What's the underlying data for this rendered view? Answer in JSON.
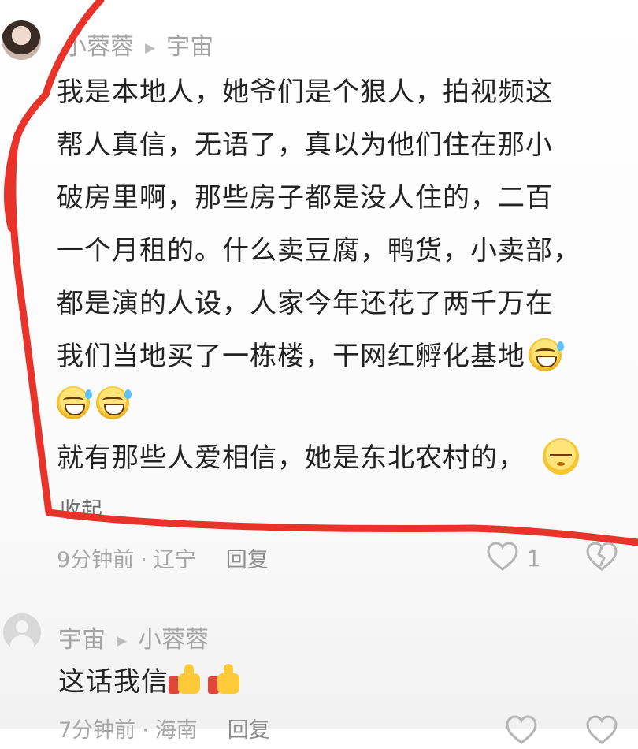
{
  "comment1": {
    "username": "小蓉蓉",
    "reply_to": "宇宙",
    "lines": [
      "我是本地人，她爷们是个狠人，拍视频这",
      "帮人真信，无语了，真以为他们住在那小",
      "破房里啊，那些房子都是没人住的，二百",
      "一个月租的。什么卖豆腐，鸭货，小卖部，",
      "都是演的人设，人家今年还花了两千万在",
      "我们当地买了一栋楼，干网红孵化基地"
    ],
    "last_line": "就有那些人爱相信，她是东北农村的，",
    "collapse_label": "收起",
    "time": "9分钟前",
    "location": "辽宁",
    "reply_label": "回复",
    "like_count": "1",
    "emoji_names": [
      "laugh-cry-emoji",
      "laugh-cry-emoji",
      "laugh-cry-emoji",
      "sleepy-emoji"
    ]
  },
  "comment2": {
    "username": "宇宙",
    "reply_to": "小蓉蓉",
    "text": "这话我信",
    "time": "7分钟前",
    "location": "海南",
    "reply_label": "回复"
  },
  "separator_glyph": "▶",
  "annotation_color": "#e8332b"
}
